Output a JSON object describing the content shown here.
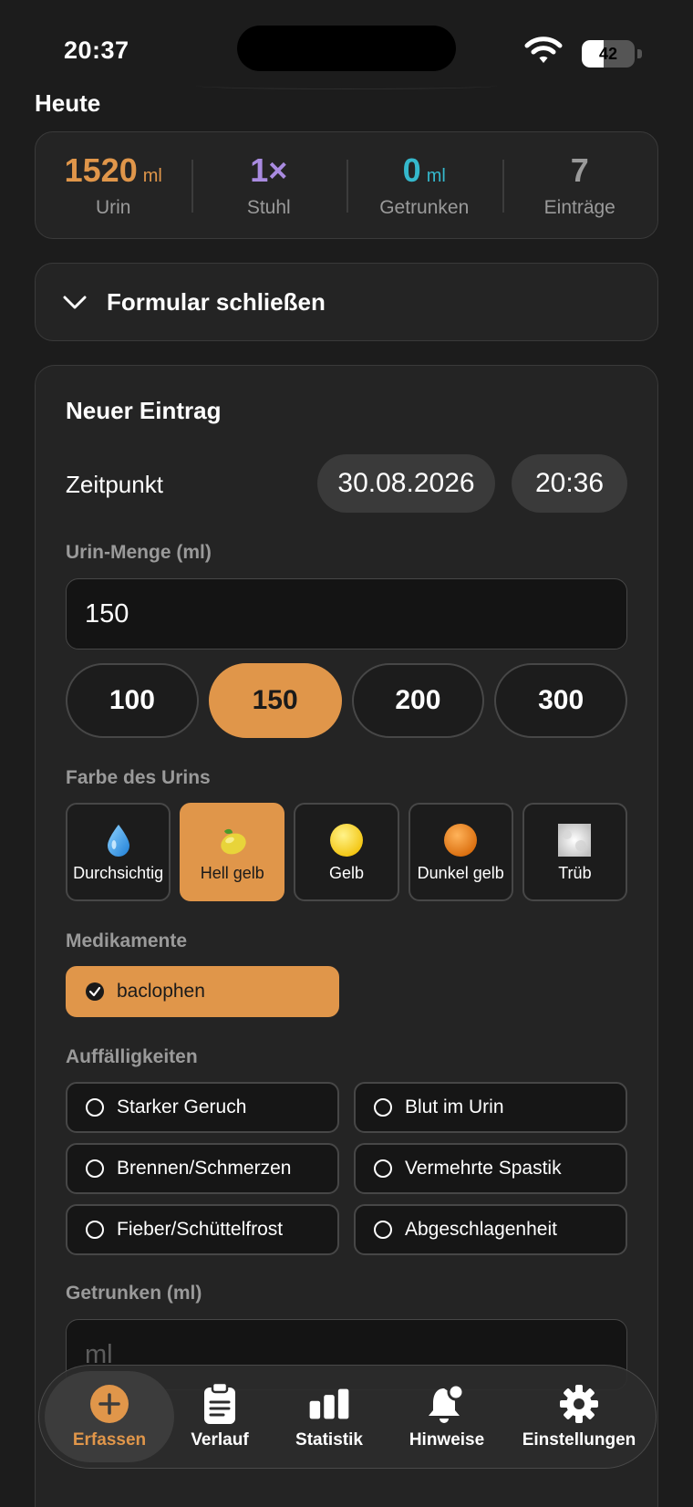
{
  "status": {
    "time": "20:37",
    "battery": "42",
    "battery_level": 0.42
  },
  "section": {
    "title": "Heute"
  },
  "summary": {
    "stats": [
      {
        "value": "1520",
        "unit": "ml",
        "label": "Urin",
        "color": "#e0964a"
      },
      {
        "value": "1×",
        "unit": "",
        "label": "Stuhl",
        "color": "#a98be0"
      },
      {
        "value": "0",
        "unit": "ml",
        "label": "Getrunken",
        "color": "#35b8cc"
      },
      {
        "value": "7",
        "unit": "",
        "label": "Einträge",
        "color": "#9a9a9a"
      }
    ]
  },
  "collapse": {
    "label": "Formular schließen"
  },
  "form": {
    "title": "Neuer Eintrag",
    "time_label": "Zeitpunkt",
    "date": "30.08.2026",
    "time": "20:36",
    "urine_label": "Urin-Menge (ml)",
    "urine_value": "150",
    "quick_amounts": [
      {
        "label": "100",
        "selected": false
      },
      {
        "label": "150",
        "selected": true
      },
      {
        "label": "200",
        "selected": false
      },
      {
        "label": "300",
        "selected": false
      }
    ],
    "color_label": "Farbe des Urins",
    "colors": [
      {
        "label": "Durchsichtig",
        "icon": "droplet-icon",
        "selected": false
      },
      {
        "label": "Hell gelb",
        "icon": "lemon-icon",
        "selected": true
      },
      {
        "label": "Gelb",
        "icon": "yellow-circle-icon",
        "selected": false
      },
      {
        "label": "Dunkel gelb",
        "icon": "orange-circle-icon",
        "selected": false
      },
      {
        "label": "Trüb",
        "icon": "cloudy-square-icon",
        "selected": false
      }
    ],
    "medication_label": "Medikamente",
    "medications": [
      {
        "label": "baclophen",
        "selected": true
      }
    ],
    "symptoms_label": "Auffälligkeiten",
    "symptoms": [
      {
        "label": "Starker Geruch",
        "selected": false
      },
      {
        "label": "Blut im Urin",
        "selected": false
      },
      {
        "label": "Brennen/Schmerzen",
        "selected": false
      },
      {
        "label": "Vermehrte Spastik",
        "selected": false
      },
      {
        "label": "Fieber/Schüttelfrost",
        "selected": false
      },
      {
        "label": "Abgeschlagenheit",
        "selected": false
      }
    ],
    "drink_label": "Getrunken (ml)",
    "drink_placeholder": "ml"
  },
  "tabs": [
    {
      "label": "Erfassen",
      "icon": "plus-circle-icon",
      "active": true
    },
    {
      "label": "Verlauf",
      "icon": "clipboard-icon",
      "active": false
    },
    {
      "label": "Statistik",
      "icon": "bar-chart-icon",
      "active": false
    },
    {
      "label": "Hinweise",
      "icon": "bell-badge-icon",
      "active": false
    },
    {
      "label": "Einstellungen",
      "icon": "gear-icon",
      "active": false
    }
  ],
  "accent_color": "#e0964a"
}
